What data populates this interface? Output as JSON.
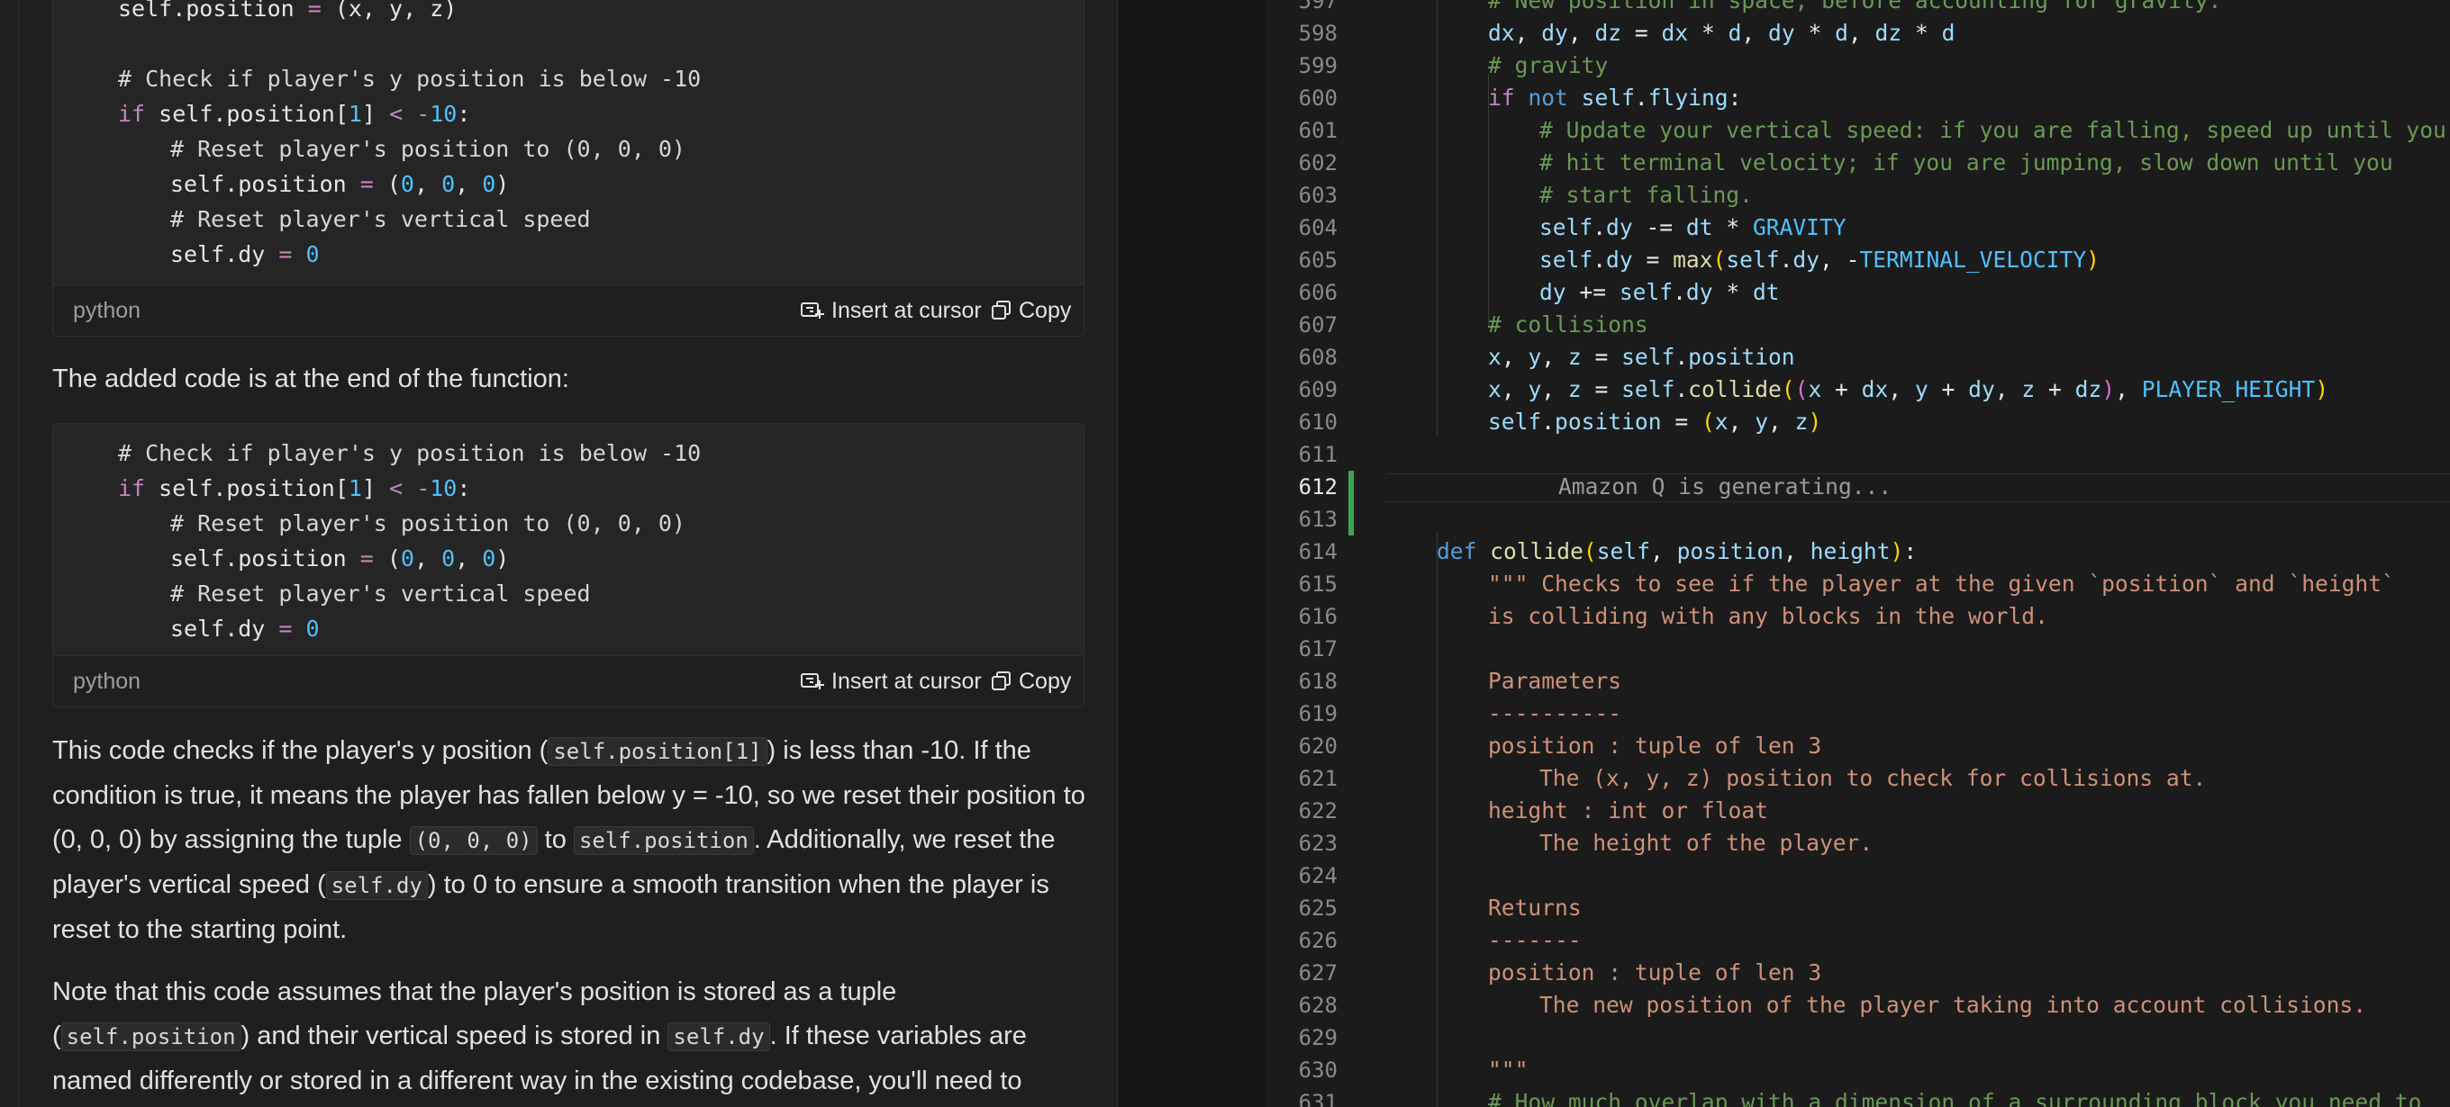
{
  "chat": {
    "block1": {
      "lines": [
        {
          "indent": 0,
          "parts": [
            [
              "self.position ",
              ""
            ],
            [
              "=",
              "op"
            ],
            [
              " (x, y, z)",
              ""
            ]
          ]
        },
        {
          "indent": 0,
          "parts": []
        },
        {
          "indent": 0,
          "parts": [
            [
              "# Check if player's y position is below -10",
              "cm"
            ]
          ]
        },
        {
          "indent": 0,
          "parts": [
            [
              "if",
              "kw"
            ],
            [
              " self.position[",
              ""
            ],
            [
              "1",
              "num"
            ],
            [
              "] ",
              ""
            ],
            [
              "<",
              "op"
            ],
            [
              " ",
              ""
            ],
            [
              "-",
              "op"
            ],
            [
              "10",
              "num"
            ],
            [
              ":",
              ""
            ]
          ]
        },
        {
          "indent": 1,
          "parts": [
            [
              "# Reset player's position to (0, 0, 0)",
              "cm"
            ]
          ]
        },
        {
          "indent": 1,
          "parts": [
            [
              "self.position ",
              ""
            ],
            [
              "=",
              "op"
            ],
            [
              " (",
              ""
            ],
            [
              "0",
              "num"
            ],
            [
              ", ",
              ""
            ],
            [
              "0",
              "num"
            ],
            [
              ", ",
              ""
            ],
            [
              "0",
              "num"
            ],
            [
              ")",
              ""
            ]
          ]
        },
        {
          "indent": 1,
          "parts": [
            [
              "# Reset player's vertical speed",
              "cm"
            ]
          ]
        },
        {
          "indent": 1,
          "parts": [
            [
              "self.dy ",
              ""
            ],
            [
              "=",
              "op"
            ],
            [
              " ",
              ""
            ],
            [
              "0",
              "num"
            ]
          ]
        }
      ],
      "language": "python"
    },
    "intro_text": "The added code is at the end of the function:",
    "block2": {
      "lines": [
        {
          "indent": 0,
          "parts": [
            [
              "# Check if player's y position is below -10",
              "cm"
            ]
          ]
        },
        {
          "indent": 0,
          "parts": [
            [
              "if",
              "kw"
            ],
            [
              " self.position[",
              ""
            ],
            [
              "1",
              "num"
            ],
            [
              "] ",
              ""
            ],
            [
              "<",
              "op"
            ],
            [
              " ",
              ""
            ],
            [
              "-",
              "op"
            ],
            [
              "10",
              "num"
            ],
            [
              ":",
              ""
            ]
          ]
        },
        {
          "indent": 1,
          "parts": [
            [
              "# Reset player's position to (0, 0, 0)",
              "cm"
            ]
          ]
        },
        {
          "indent": 1,
          "parts": [
            [
              "self.position ",
              ""
            ],
            [
              "=",
              "op"
            ],
            [
              " (",
              ""
            ],
            [
              "0",
              "num"
            ],
            [
              ", ",
              ""
            ],
            [
              "0",
              "num"
            ],
            [
              ", ",
              ""
            ],
            [
              "0",
              "num"
            ],
            [
              ")",
              ""
            ]
          ]
        },
        {
          "indent": 1,
          "parts": [
            [
              "# Reset player's vertical speed",
              "cm"
            ]
          ]
        },
        {
          "indent": 1,
          "parts": [
            [
              "self.dy ",
              ""
            ],
            [
              "=",
              "op"
            ],
            [
              " ",
              ""
            ],
            [
              "0",
              "num"
            ]
          ]
        }
      ],
      "language": "python"
    },
    "insert_label": "Insert at cursor",
    "copy_label": "Copy",
    "paragraph1": {
      "t1": "This code checks if the player's y position (",
      "c1": "self.position[1]",
      "t2": ") is less than -10. If the condition is true, it means the player has fallen below y = -10, so we reset their position to (0, 0, 0) by assigning the tuple ",
      "c2": "(0, 0, 0)",
      "t3": " to ",
      "c3": "self.position",
      "t4": ". Additionally, we reset the player's vertical speed (",
      "c4": "self.dy",
      "t5": ") to 0 to ensure a smooth transition when the player is reset to the starting point."
    },
    "paragraph2": {
      "t1": "Note that this code assumes that the player's position is stored as a tuple (",
      "c1": "self.position",
      "t2": ") and their vertical speed is stored in ",
      "c2": "self.dy",
      "t3": ". If these variables are named differently or stored in a different way in the existing codebase, you'll need to"
    }
  },
  "editor": {
    "generating_text": "Amazon Q is generating...",
    "active_line": "612",
    "lines": [
      {
        "n": "597",
        "indent": 2,
        "parts": [
          [
            "# New position in space, before accounting for gravity.",
            "e-cm"
          ]
        ]
      },
      {
        "n": "598",
        "indent": 2,
        "parts": [
          [
            "dx",
            "e-var"
          ],
          [
            ", ",
            "e-w"
          ],
          [
            "dy",
            "e-var"
          ],
          [
            ", ",
            "e-w"
          ],
          [
            "dz",
            "e-var"
          ],
          [
            " = ",
            "e-w"
          ],
          [
            "dx",
            "e-var"
          ],
          [
            " * ",
            "e-w"
          ],
          [
            "d",
            "e-var"
          ],
          [
            ", ",
            "e-w"
          ],
          [
            "dy",
            "e-var"
          ],
          [
            " * ",
            "e-w"
          ],
          [
            "d",
            "e-var"
          ],
          [
            ", ",
            "e-w"
          ],
          [
            "dz",
            "e-var"
          ],
          [
            " * ",
            "e-w"
          ],
          [
            "d",
            "e-var"
          ]
        ]
      },
      {
        "n": "599",
        "indent": 2,
        "parts": [
          [
            "# gravity",
            "e-cm"
          ]
        ]
      },
      {
        "n": "600",
        "indent": 2,
        "parts": [
          [
            "if",
            "e-kw"
          ],
          [
            " ",
            "e-w"
          ],
          [
            "not",
            "e-kb"
          ],
          [
            " ",
            "e-w"
          ],
          [
            "self",
            "e-var"
          ],
          [
            ".",
            "e-w"
          ],
          [
            "flying",
            "e-var"
          ],
          [
            ":",
            "e-w"
          ]
        ]
      },
      {
        "n": "601",
        "indent": 3,
        "parts": [
          [
            "# Update your vertical speed: if you are falling, speed up until you",
            "e-cm"
          ]
        ]
      },
      {
        "n": "602",
        "indent": 3,
        "parts": [
          [
            "# hit terminal velocity; if you are jumping, slow down until you",
            "e-cm"
          ]
        ]
      },
      {
        "n": "603",
        "indent": 3,
        "parts": [
          [
            "# start falling.",
            "e-cm"
          ]
        ]
      },
      {
        "n": "604",
        "indent": 3,
        "parts": [
          [
            "self",
            "e-var"
          ],
          [
            ".",
            "e-w"
          ],
          [
            "dy",
            "e-var"
          ],
          [
            " -= ",
            "e-w"
          ],
          [
            "dt",
            "e-var"
          ],
          [
            " * ",
            "e-w"
          ],
          [
            "GRAVITY",
            "e-cst"
          ]
        ]
      },
      {
        "n": "605",
        "indent": 3,
        "parts": [
          [
            "self",
            "e-var"
          ],
          [
            ".",
            "e-w"
          ],
          [
            "dy",
            "e-var"
          ],
          [
            " = ",
            "e-w"
          ],
          [
            "max",
            "e-fn"
          ],
          [
            "(",
            "e-p1"
          ],
          [
            "self",
            "e-var"
          ],
          [
            ".",
            "e-w"
          ],
          [
            "dy",
            "e-var"
          ],
          [
            ", -",
            "e-w"
          ],
          [
            "TERMINAL_VELOCITY",
            "e-cst"
          ],
          [
            ")",
            "e-p1"
          ]
        ]
      },
      {
        "n": "606",
        "indent": 3,
        "parts": [
          [
            "dy",
            "e-var"
          ],
          [
            " += ",
            "e-w"
          ],
          [
            "self",
            "e-var"
          ],
          [
            ".",
            "e-w"
          ],
          [
            "dy",
            "e-var"
          ],
          [
            " * ",
            "e-w"
          ],
          [
            "dt",
            "e-var"
          ]
        ]
      },
      {
        "n": "607",
        "indent": 2,
        "parts": [
          [
            "# collisions",
            "e-cm"
          ]
        ]
      },
      {
        "n": "608",
        "indent": 2,
        "parts": [
          [
            "x",
            "e-var"
          ],
          [
            ", ",
            "e-w"
          ],
          [
            "y",
            "e-var"
          ],
          [
            ", ",
            "e-w"
          ],
          [
            "z",
            "e-var"
          ],
          [
            " = ",
            "e-w"
          ],
          [
            "self",
            "e-var"
          ],
          [
            ".",
            "e-w"
          ],
          [
            "position",
            "e-var"
          ]
        ]
      },
      {
        "n": "609",
        "indent": 2,
        "parts": [
          [
            "x",
            "e-var"
          ],
          [
            ", ",
            "e-w"
          ],
          [
            "y",
            "e-var"
          ],
          [
            ", ",
            "e-w"
          ],
          [
            "z",
            "e-var"
          ],
          [
            " = ",
            "e-w"
          ],
          [
            "self",
            "e-var"
          ],
          [
            ".",
            "e-w"
          ],
          [
            "collide",
            "e-fn"
          ],
          [
            "(",
            "e-p1"
          ],
          [
            "(",
            "e-p2"
          ],
          [
            "x",
            "e-var"
          ],
          [
            " + ",
            "e-w"
          ],
          [
            "dx",
            "e-var"
          ],
          [
            ", ",
            "e-w"
          ],
          [
            "y",
            "e-var"
          ],
          [
            " + ",
            "e-w"
          ],
          [
            "dy",
            "e-var"
          ],
          [
            ", ",
            "e-w"
          ],
          [
            "z",
            "e-var"
          ],
          [
            " + ",
            "e-w"
          ],
          [
            "dz",
            "e-var"
          ],
          [
            ")",
            "e-p2"
          ],
          [
            ", ",
            "e-w"
          ],
          [
            "PLAYER_HEIGHT",
            "e-cst"
          ],
          [
            ")",
            "e-p1"
          ]
        ]
      },
      {
        "n": "610",
        "indent": 2,
        "parts": [
          [
            "self",
            "e-var"
          ],
          [
            ".",
            "e-w"
          ],
          [
            "position",
            "e-var"
          ],
          [
            " = ",
            "e-w"
          ],
          [
            "(",
            "e-p1"
          ],
          [
            "x",
            "e-var"
          ],
          [
            ", ",
            "e-w"
          ],
          [
            "y",
            "e-var"
          ],
          [
            ", ",
            "e-w"
          ],
          [
            "z",
            "e-var"
          ],
          [
            ")",
            "e-p1"
          ]
        ]
      },
      {
        "n": "611",
        "indent": 0,
        "parts": []
      },
      {
        "n": "612",
        "indent": 0,
        "parts": [],
        "generating": true
      },
      {
        "n": "613",
        "indent": 0,
        "parts": []
      },
      {
        "n": "614",
        "indent": 1,
        "parts": [
          [
            "def",
            "e-kb"
          ],
          [
            " ",
            "e-w"
          ],
          [
            "collide",
            "e-fn"
          ],
          [
            "(",
            "e-p1"
          ],
          [
            "self",
            "e-var"
          ],
          [
            ", ",
            "e-w"
          ],
          [
            "position",
            "e-var"
          ],
          [
            ", ",
            "e-w"
          ],
          [
            "height",
            "e-var"
          ],
          [
            ")",
            "e-p1"
          ],
          [
            ":",
            "e-w"
          ]
        ]
      },
      {
        "n": "615",
        "indent": 2,
        "parts": [
          [
            "\"\"\" Checks to see if the player at the given `position` and `height`",
            "e-str"
          ]
        ]
      },
      {
        "n": "616",
        "indent": 2,
        "parts": [
          [
            "is colliding with any blocks in the world.",
            "e-str"
          ]
        ]
      },
      {
        "n": "617",
        "indent": 0,
        "parts": []
      },
      {
        "n": "618",
        "indent": 2,
        "parts": [
          [
            "Parameters",
            "e-str"
          ]
        ]
      },
      {
        "n": "619",
        "indent": 2,
        "parts": [
          [
            "----------",
            "e-str"
          ]
        ]
      },
      {
        "n": "620",
        "indent": 2,
        "parts": [
          [
            "position : tuple of len 3",
            "e-str"
          ]
        ]
      },
      {
        "n": "621",
        "indent": 3,
        "parts": [
          [
            "The (x, y, z) position to check for collisions at.",
            "e-str"
          ]
        ]
      },
      {
        "n": "622",
        "indent": 2,
        "parts": [
          [
            "height : int or float",
            "e-str"
          ]
        ]
      },
      {
        "n": "623",
        "indent": 3,
        "parts": [
          [
            "The height of the player.",
            "e-str"
          ]
        ]
      },
      {
        "n": "624",
        "indent": 0,
        "parts": []
      },
      {
        "n": "625",
        "indent": 2,
        "parts": [
          [
            "Returns",
            "e-str"
          ]
        ]
      },
      {
        "n": "626",
        "indent": 2,
        "parts": [
          [
            "-------",
            "e-str"
          ]
        ]
      },
      {
        "n": "627",
        "indent": 2,
        "parts": [
          [
            "position : tuple of len 3",
            "e-str"
          ]
        ]
      },
      {
        "n": "628",
        "indent": 3,
        "parts": [
          [
            "The new position of the player taking into account collisions.",
            "e-str"
          ]
        ]
      },
      {
        "n": "629",
        "indent": 0,
        "parts": []
      },
      {
        "n": "630",
        "indent": 2,
        "parts": [
          [
            "\"\"\"",
            "e-str"
          ]
        ]
      },
      {
        "n": "631",
        "indent": 2,
        "parts": [
          [
            "# How much overlap with a dimension of a surrounding block you need to",
            "e-cm"
          ]
        ]
      }
    ]
  },
  "colors": {
    "accent_green": "#3fa34d",
    "background": "#1e1e1e"
  }
}
